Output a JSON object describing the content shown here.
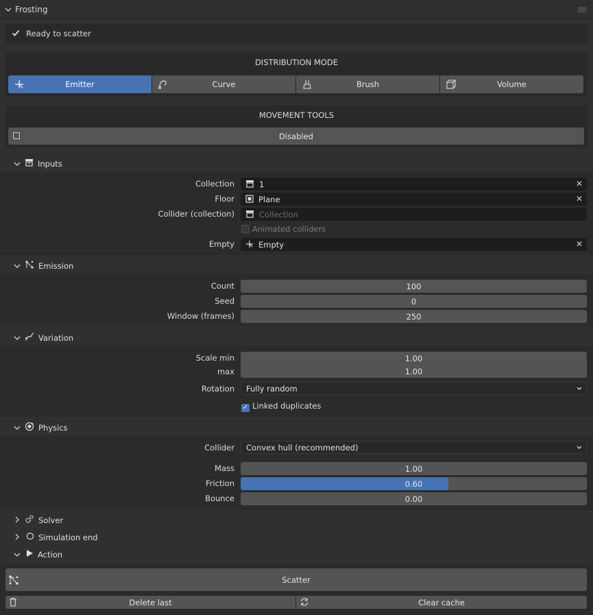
{
  "panel": {
    "title": "Frosting"
  },
  "status": {
    "text": "Ready to scatter"
  },
  "distribution": {
    "heading": "DISTRIBUTION MODE",
    "modes": [
      {
        "label": "Emitter",
        "icon": "emitter-icon",
        "active": true
      },
      {
        "label": "Curve",
        "icon": "curve-icon",
        "active": false
      },
      {
        "label": "Brush",
        "icon": "brush-icon",
        "active": false
      },
      {
        "label": "Volume",
        "icon": "volume-icon",
        "active": false
      }
    ]
  },
  "movement": {
    "heading": "MOVEMENT TOOLS",
    "toggle_label": "Disabled"
  },
  "inputs": {
    "title": "Inputs",
    "collection_label": "Collection",
    "collection_value": "1",
    "floor_label": "Floor",
    "floor_value": "Plane",
    "collider_label": "Collider (collection)",
    "collider_placeholder": "Collection",
    "animated_label": "Animated colliders",
    "empty_label": "Empty",
    "empty_value": "Empty"
  },
  "emission": {
    "title": "Emission",
    "count_label": "Count",
    "count_value": "100",
    "seed_label": "Seed",
    "seed_value": "0",
    "window_label": "Window (frames)",
    "window_value": "250"
  },
  "variation": {
    "title": "Variation",
    "scale_min_label": "Scale min",
    "scale_min_value": "1.00",
    "max_label": "max",
    "max_value": "1.00",
    "rotation_label": "Rotation",
    "rotation_value": "Fully random",
    "linked_label": "Linked duplicates"
  },
  "physics": {
    "title": "Physics",
    "collider_label": "Collider",
    "collider_value": "Convex hull (recommended)",
    "mass_label": "Mass",
    "mass_value": "1.00",
    "friction_label": "Friction",
    "friction_value": "0.60",
    "friction_fraction": 0.6,
    "bounce_label": "Bounce",
    "bounce_value": "0.00"
  },
  "collapsed": {
    "solver": "Solver",
    "simulation_end": "Simulation end"
  },
  "action": {
    "title": "Action",
    "scatter_label": "Scatter",
    "delete_label": "Delete last",
    "clear_label": "Clear cache"
  },
  "colors": {
    "accent": "#4772b3",
    "background": "#303030",
    "field": "#1d1d1d",
    "button": "#545454"
  }
}
